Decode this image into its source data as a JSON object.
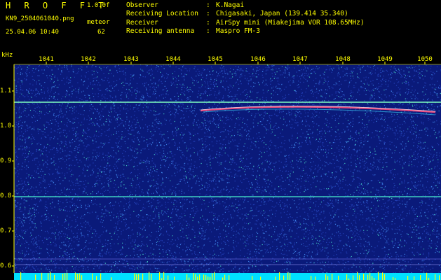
{
  "header": {
    "app_name": "HROFFT",
    "version": "1.0.0f",
    "filename": "KN9_2504061040.png",
    "mode": "meteor",
    "datetime": "25.04.06 10:40",
    "count": "62"
  },
  "info": {
    "rows": [
      {
        "label": "Observer",
        "value": "K.Nagai"
      },
      {
        "label": "Receiving Location",
        "value": "Chigasaki, Japan (139.414 35.340)"
      },
      {
        "label": "Receiver",
        "value": "AirSpy mini (Miakejima VOR 108.65MHz)"
      },
      {
        "label": "Receiving antenna",
        "value": "Maspro FM-3"
      }
    ],
    "separator": ":"
  },
  "spectrogram": {
    "y_unit": "kHz",
    "x_ticks": [
      "1041",
      "1042",
      "1043",
      "1044",
      "1045",
      "1046",
      "1047",
      "1048",
      "1049",
      "1050"
    ],
    "y_ticks": [
      "1.1",
      "1.0",
      "0.9",
      "0.8",
      "0.7",
      "0.6"
    ],
    "background_color": "#0a1a7a",
    "noise_color": "#3050d0",
    "line_color": "#7fffc0",
    "trail_color": "#ff5080",
    "bottom_bar_color": "#00e0ff",
    "bottom_spike_color": "#ffff00"
  }
}
